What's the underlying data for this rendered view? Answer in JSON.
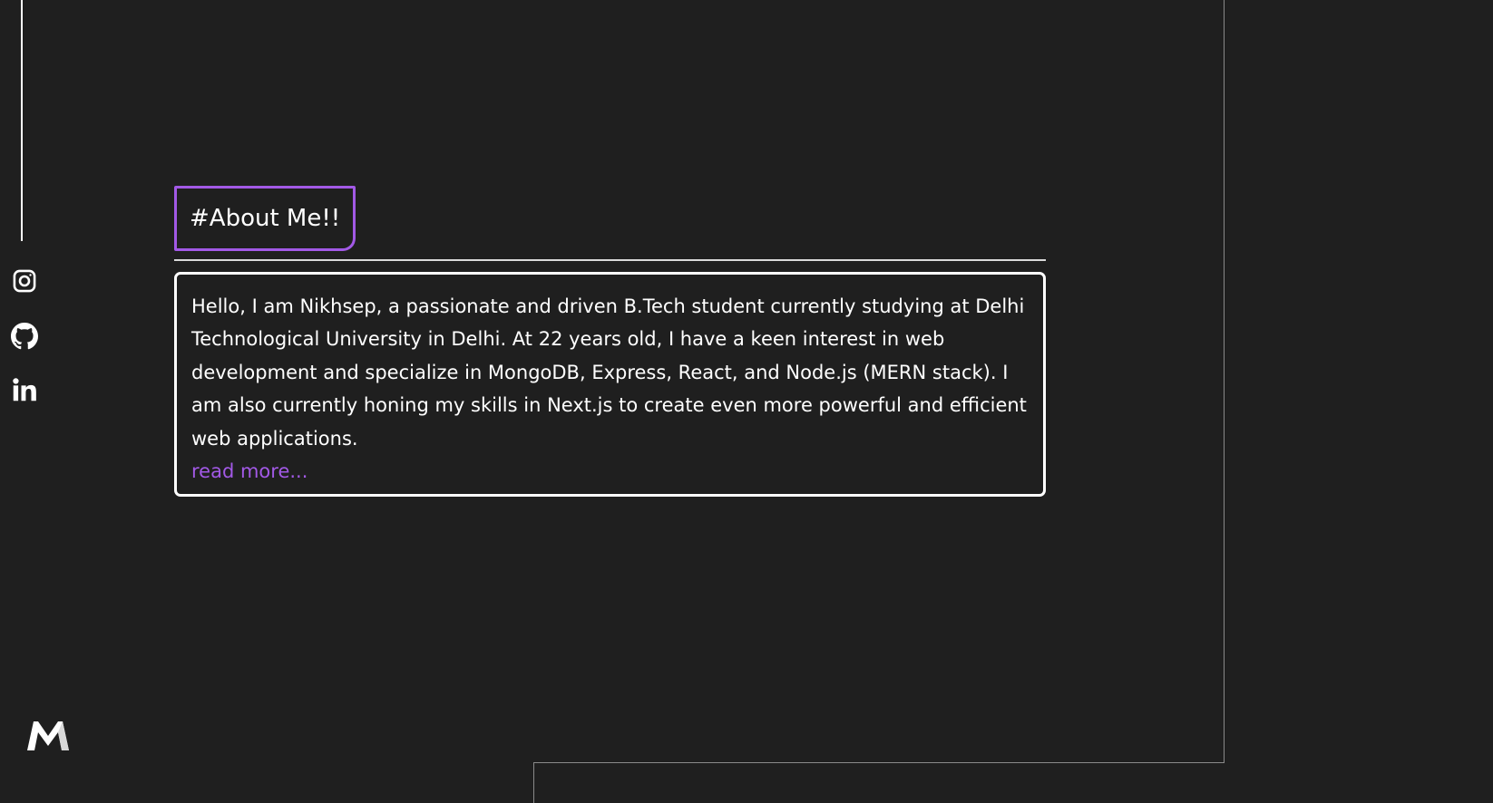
{
  "sidebar": {
    "social_links": [
      {
        "name": "instagram",
        "icon": "instagram-icon"
      },
      {
        "name": "github",
        "icon": "github-icon"
      },
      {
        "name": "linkedin",
        "icon": "linkedin-icon"
      }
    ]
  },
  "about": {
    "heading": "#About Me!!",
    "paragraph": "Hello, I am Nikhsep, a passionate and driven B.Tech student currently studying at Delhi Technological University in Delhi. At 22 years old, I have a keen interest in web development and specialize in MongoDB, Express, React, and Node.js (MERN stack). I am also currently honing my skills in Next.js to create even more powerful and efficient web applications.",
    "read_more": "read more..."
  },
  "logo": {
    "icon": "m-logo-icon"
  },
  "colors": {
    "background": "#1f1f1f",
    "accent": "#a259e6",
    "text": "#ffffff"
  }
}
